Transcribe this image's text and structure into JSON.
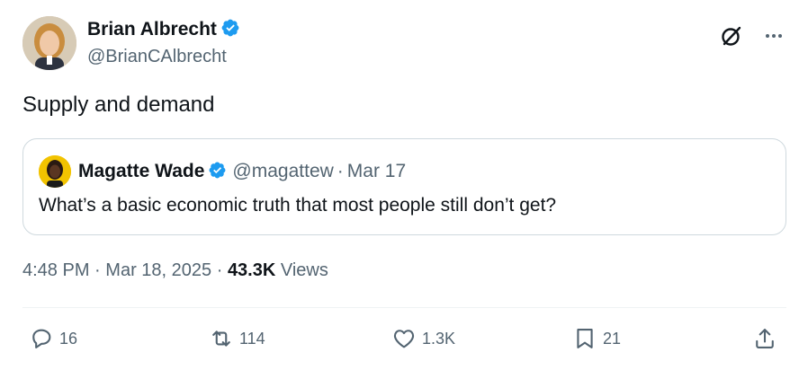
{
  "author": {
    "name": "Brian Albrecht",
    "handle": "@BrianCAlbrecht",
    "verified": true,
    "verified_color": "#1d9bf0"
  },
  "tweet": {
    "text": "Supply and demand"
  },
  "quoted_tweet": {
    "name": "Magatte Wade",
    "handle": "@magattew",
    "separator": "·",
    "date": "Mar 17",
    "verified": true,
    "text": "What’s a basic economic truth that most people still don’t get?"
  },
  "meta": {
    "time": "4:48 PM",
    "separator": "·",
    "date": "Mar 18, 2025",
    "views_count": "43.3K",
    "views_label": "Views"
  },
  "actions": {
    "replies": "16",
    "reposts": "114",
    "likes": "1.3K",
    "bookmarks": "21"
  },
  "icons": {
    "header": [
      "grok-icon",
      "more-icon"
    ],
    "actions": [
      "reply-icon",
      "repost-icon",
      "like-icon",
      "bookmark-icon",
      "share-icon"
    ]
  },
  "colors": {
    "text_primary": "#0f1419",
    "text_secondary": "#536471",
    "border": "#cfd9de",
    "accent": "#1d9bf0"
  }
}
